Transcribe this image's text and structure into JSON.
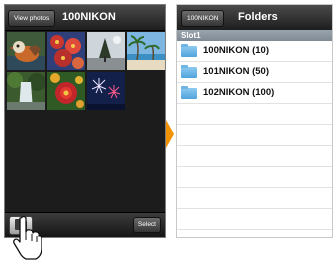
{
  "left_screen": {
    "back_label": "View photos",
    "title": "100NIKON",
    "select_label": "Select",
    "thumbnails": [
      "mandarin-duck",
      "flowers",
      "tree",
      "beach-palms",
      "waterfall-forest",
      "red-flower",
      "fireworks"
    ],
    "folder_button_icon": "folder-icon"
  },
  "right_screen": {
    "back_label": "100NIKON",
    "title": "Folders",
    "section_header": "Slot1",
    "folders": [
      {
        "label": "100NIKON (10)"
      },
      {
        "label": "101NIKON (50)"
      },
      {
        "label": "102NIKON (100)"
      }
    ]
  },
  "overlay": {
    "pointer_icon": "hand-pointer-icon",
    "arrow_icon": "orange-arrow-icon",
    "arrow_color": "#f39200"
  },
  "colors": {
    "nav_bar": "#2a2a2a",
    "section_header": "#8a949d",
    "folder_icon": "#5aa9df"
  }
}
